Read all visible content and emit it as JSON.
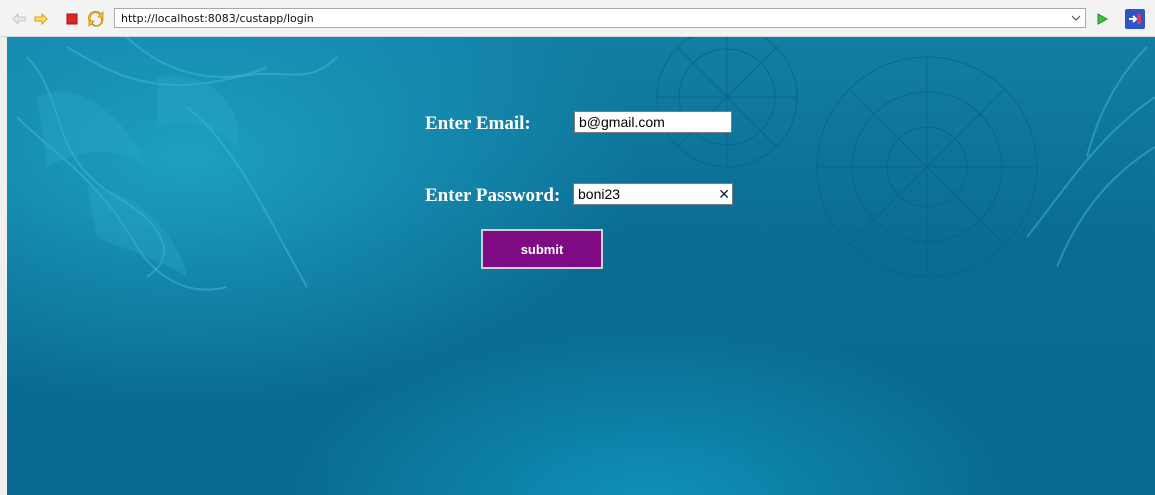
{
  "browser": {
    "url": "http://localhost:8083/custapp/login",
    "icons": [
      "back-arrow-icon",
      "forward-arrow-icon",
      "stop-icon",
      "refresh-icon",
      "dropdown-chevron-icon",
      "go-play-icon",
      "open-external-icon"
    ]
  },
  "form": {
    "email_label": "Enter Email:",
    "email_value": "b@gmail.com",
    "password_label": "Enter Password:",
    "password_value": "boni23",
    "submit_label": "submit"
  },
  "colors": {
    "background": "#0b6c93",
    "submit_button": "#7e0a84",
    "label_text": "#ffffff"
  }
}
